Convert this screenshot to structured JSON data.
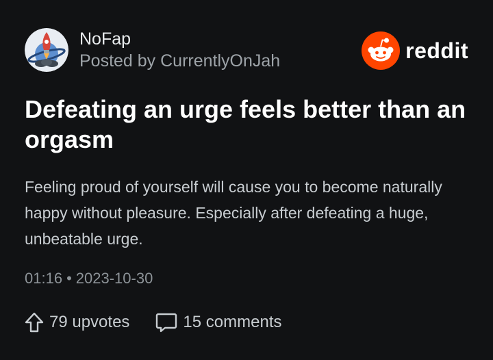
{
  "post": {
    "subreddit": "NoFap",
    "posted_by": "Posted by CurrentlyOnJah",
    "title": "Defeating an urge feels better than an orgasm",
    "body": "Feeling proud of yourself will cause you to become naturally happy without pleasure. Especially after defeating a huge, unbeatable urge.",
    "time": "01:16",
    "date": "2023-10-30",
    "upvotes_label": "79 upvotes",
    "comments_label": "15 comments"
  },
  "brand": {
    "name": "reddit",
    "logo_color": "#ff4500"
  },
  "icons": {
    "avatar": "rocket-planet-avatar",
    "brand": "reddit-snoo-icon",
    "upvote": "upvote-arrow-icon",
    "comment": "comment-bubble-icon"
  },
  "colors": {
    "background": "#111214",
    "text_primary": "#ffffff",
    "text_secondary": "#9da3a8"
  }
}
